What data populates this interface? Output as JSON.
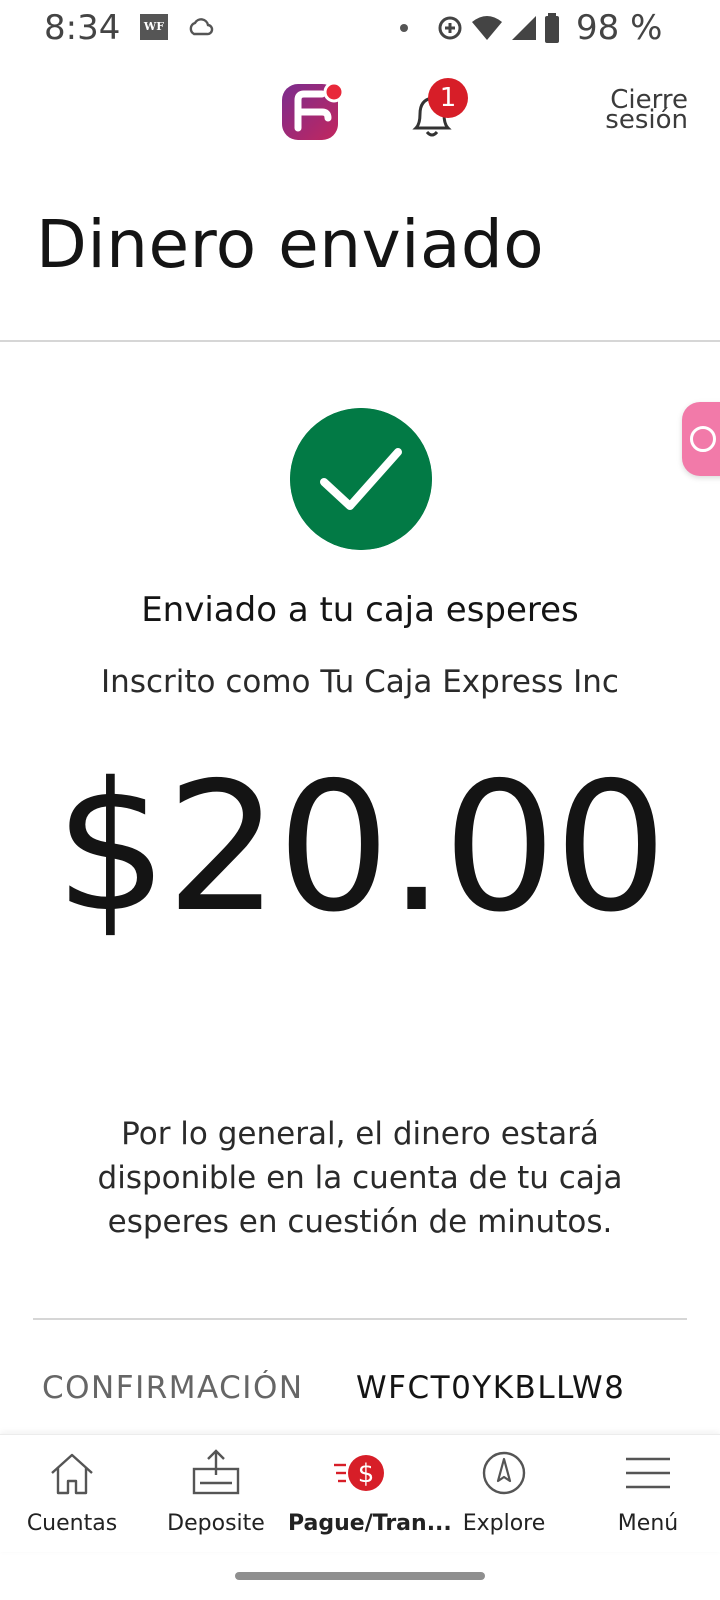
{
  "status_bar": {
    "time": "8:34",
    "carrier_badge": "WF",
    "battery": "98 %"
  },
  "header": {
    "logout_line1": "Cierre",
    "logout_line2": "sesión",
    "notification_count": "1"
  },
  "page": {
    "title": "Dinero enviado"
  },
  "confirmation": {
    "recipient": "Enviado a tu caja esperes",
    "enrolled_as": "Inscrito como Tu Caja Express Inc",
    "amount": "$20.00",
    "note": "Por lo general, el dinero estará disponible en la cuenta de tu caja esperes en cuestión de minutos.",
    "label": "CONFIRMACIÓN",
    "code": "WFCT0YKBLLW8"
  },
  "colors": {
    "success_green": "#027a45",
    "brand_red": "#d71e28",
    "fab_pink": "#f27aa9"
  },
  "bottom_nav": [
    {
      "label": "Cuentas",
      "icon": "home-icon",
      "active": false
    },
    {
      "label": "Deposite",
      "icon": "deposit-icon",
      "active": false
    },
    {
      "label": "Pague/Tran...",
      "icon": "pay-transfer-icon",
      "active": true
    },
    {
      "label": "Explore",
      "icon": "compass-icon",
      "active": false
    },
    {
      "label": "Menú",
      "icon": "menu-icon",
      "active": false
    }
  ]
}
